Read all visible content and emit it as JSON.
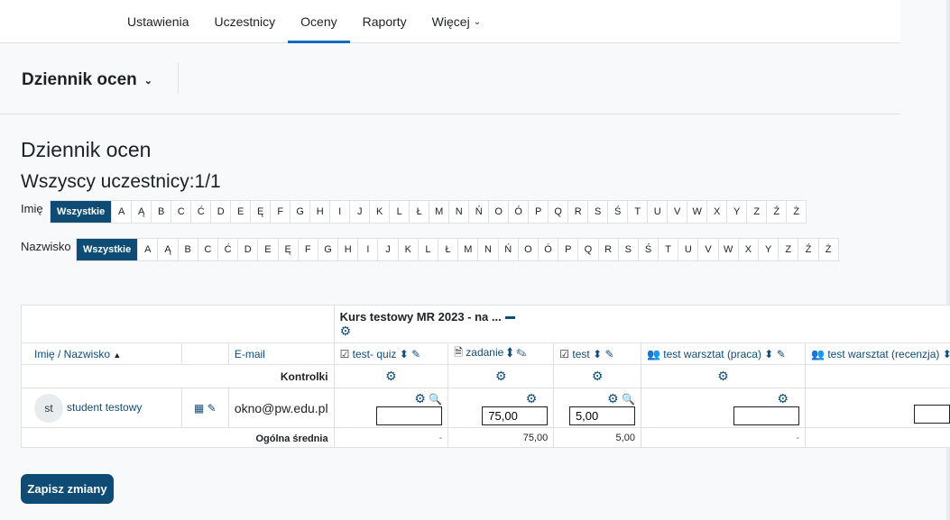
{
  "nav": {
    "items": [
      {
        "label": "Ustawienia"
      },
      {
        "label": "Uczestnicy"
      },
      {
        "label": "Oceny"
      },
      {
        "label": "Raporty"
      },
      {
        "label": "Więcej"
      }
    ],
    "active": "Oceny"
  },
  "page_selector": "Dziennik ocen",
  "title": "Dziennik ocen",
  "subtitle": "Wszyscy uczestnicy:1/1",
  "filters": {
    "first_name_label": "Imię",
    "last_name_label": "Nazwisko",
    "all_label": "Wszystkie",
    "letters": [
      "A",
      "Ą",
      "B",
      "C",
      "Ć",
      "D",
      "E",
      "Ę",
      "F",
      "G",
      "H",
      "I",
      "J",
      "K",
      "L",
      "Ł",
      "M",
      "N",
      "Ń",
      "O",
      "Ó",
      "P",
      "Q",
      "R",
      "S",
      "Ś",
      "T",
      "U",
      "V",
      "W",
      "X",
      "Y",
      "Z",
      "Ź",
      "Ż"
    ]
  },
  "table": {
    "category": "Kurs testowy MR 2023 - na ...",
    "headers": {
      "name": "Imię / Nazwisko",
      "email": "E-mail",
      "cols": [
        "test- quiz",
        "zadanie",
        "test",
        "test warsztat (praca)",
        "test warsztat (recenzja)"
      ]
    },
    "controls_label": "Kontrolki",
    "student": {
      "initials": "st",
      "name": "student testowy",
      "email": "okno@pw.edu.pl",
      "grades": [
        "",
        "75,00",
        "5,00",
        "",
        ""
      ]
    },
    "average_label": "Ogólna średnia",
    "averages": [
      "-",
      "75,00",
      "5,00",
      "-"
    ]
  },
  "save_button": "Zapisz zmiany",
  "colors": {
    "primary": "#0f4c75",
    "accent": "#0f6cbf"
  }
}
